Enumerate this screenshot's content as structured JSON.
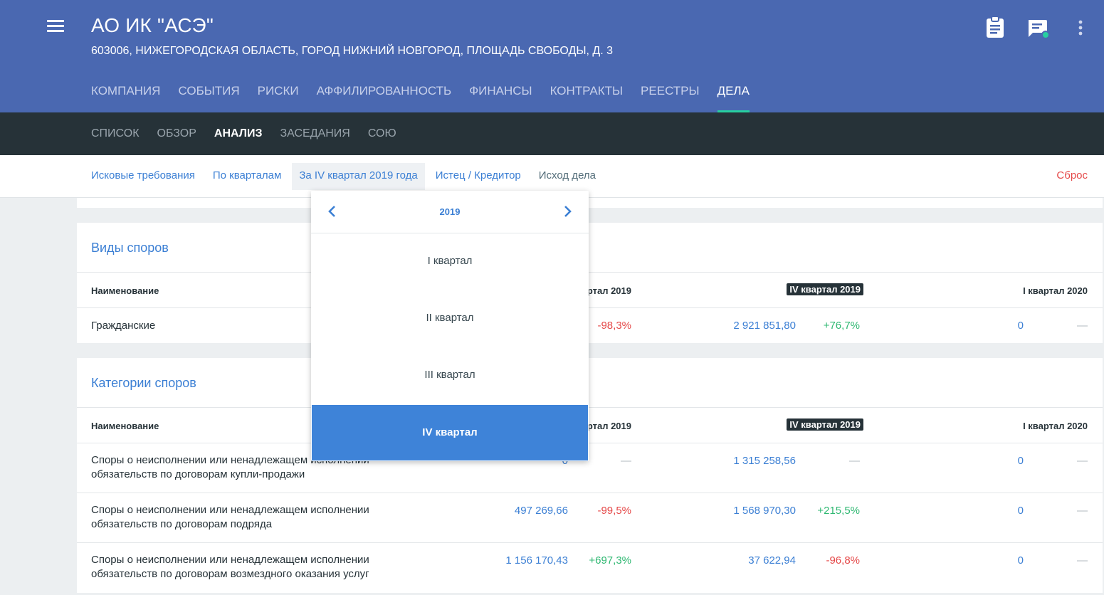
{
  "header": {
    "company_name": "АО ИК \"АСЭ\"",
    "company_address": "603006, НИЖЕГОРОДСКАЯ ОБЛАСТЬ, ГОРОД НИЖНИЙ НОВГОРОД, ПЛОЩАДЬ СВОБОДЫ, Д. 3",
    "icons": [
      "menu-icon",
      "clipboard-icon",
      "chat-icon",
      "more-vert-icon"
    ],
    "notification_dot_color": "#27cfa0"
  },
  "main_tabs": [
    "КОМПАНИЯ",
    "СОБЫТИЯ",
    "РИСКИ",
    "АФФИЛИРОВАННОСТЬ",
    "ФИНАНСЫ",
    "КОНТРАКТЫ",
    "РЕЕСТРЫ",
    "ДЕЛА"
  ],
  "main_tab_active": "ДЕЛА",
  "sub_tabs": [
    "СПИСОК",
    "ОБЗОР",
    "АНАЛИЗ",
    "ЗАСЕДАНИЯ",
    "СОЮ"
  ],
  "sub_tab_active": "АНАЛИЗ",
  "filters": [
    "Исковые требования",
    "По кварталам",
    "За IV квартал 2019 года",
    "Истец / Кредитор",
    "Исход дела"
  ],
  "reset_label": "Сброс",
  "dropdown": {
    "year": "2019",
    "items": [
      "I квартал",
      "II квартал",
      "III квартал",
      "IV квартал"
    ],
    "selected": "IV квартал"
  },
  "section1": {
    "title": "Виды споров",
    "col_name": "Наименование",
    "col_q3": "ртал 2019",
    "col_q4": "IV квартал 2019",
    "col_q1": "I квартал 2020",
    "rows": [
      {
        "name": "Гражданские",
        "q3_pct": "-98,3%",
        "q4_value": "2 921 851,80",
        "q4_pct": "+76,7%",
        "q1_value": "0",
        "q1_pct": "—"
      }
    ]
  },
  "section2": {
    "title": "Категории споров",
    "col_name": "Наименование",
    "col_q3": "ртал 2019",
    "col_q4": "IV квартал 2019",
    "col_q1": "I квартал 2020",
    "rows": [
      {
        "name_1": "Споры о неисполнении или ненадлежащем исполнении",
        "name_2": "обязательств по договорам купли-продажи",
        "q3_value": "0",
        "q3_pct": "—",
        "q4_value": "1 315 258,56",
        "q4_pct": "—",
        "q1_value": "0",
        "q1_pct": "—"
      },
      {
        "name_1": "Споры о неисполнении или ненадлежащем исполнении",
        "name_2": "обязательств по договорам подряда",
        "q3_value": "497 269,66",
        "q3_pct": "-99,5%",
        "q4_value": "1 568 970,30",
        "q4_pct": "+215,5%",
        "q1_value": "0",
        "q1_pct": "—"
      },
      {
        "name_1": "Споры о неисполнении или ненадлежащем исполнении",
        "name_2": "обязательств по договорам возмездного оказания услуг",
        "q3_value": "1 156 170,43",
        "q3_pct": "+697,3%",
        "q4_value": "37 622,94",
        "q4_pct": "-96,8%",
        "q1_value": "0",
        "q1_pct": "—"
      }
    ]
  }
}
